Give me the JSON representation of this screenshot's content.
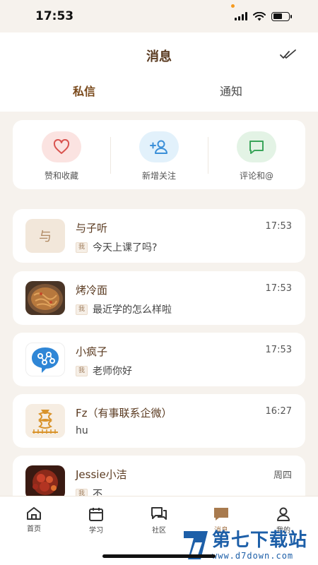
{
  "status_bar": {
    "time": "17:53"
  },
  "header": {
    "title": "消息"
  },
  "tabs": [
    {
      "label": "私信",
      "active": true
    },
    {
      "label": "通知",
      "active": false
    }
  ],
  "quick_actions": [
    {
      "label": "赞和收藏",
      "icon": "heart-icon",
      "color": "#d9534f"
    },
    {
      "label": "新增关注",
      "icon": "add-user-icon",
      "color": "#3a8fd8"
    },
    {
      "label": "评论和@",
      "icon": "comment-icon",
      "color": "#3aa55a"
    }
  ],
  "conversations": [
    {
      "name": "与子听",
      "avatar_text": "与",
      "time": "17:53",
      "tag": "我",
      "preview": "今天上课了吗?"
    },
    {
      "name": "烤冷面",
      "time": "17:53",
      "tag": "我",
      "preview": "最近学的怎么样啦"
    },
    {
      "name": "小疯子",
      "time": "17:53",
      "tag": "我",
      "preview": "老师你好"
    },
    {
      "name": "Fz（有事联系企微）",
      "time": "16:27",
      "tag": "",
      "preview": "hu"
    },
    {
      "name": "Jessie小洁",
      "time": "周四",
      "tag": "我",
      "preview": "不"
    }
  ],
  "bottom_nav": [
    {
      "label": "首页",
      "icon": "home-icon",
      "active": false
    },
    {
      "label": "学习",
      "icon": "calendar-icon",
      "active": false
    },
    {
      "label": "社区",
      "icon": "community-icon",
      "active": false
    },
    {
      "label": "消息",
      "icon": "message-icon",
      "active": true
    },
    {
      "label": "我的",
      "icon": "profile-icon",
      "active": false
    }
  ],
  "watermark": {
    "brand": "第七下载站",
    "url": "www.d7down.com"
  },
  "colors": {
    "accent": "#a87a4e",
    "brand_brown": "#5a3a20",
    "background": "#f6f2ed"
  }
}
